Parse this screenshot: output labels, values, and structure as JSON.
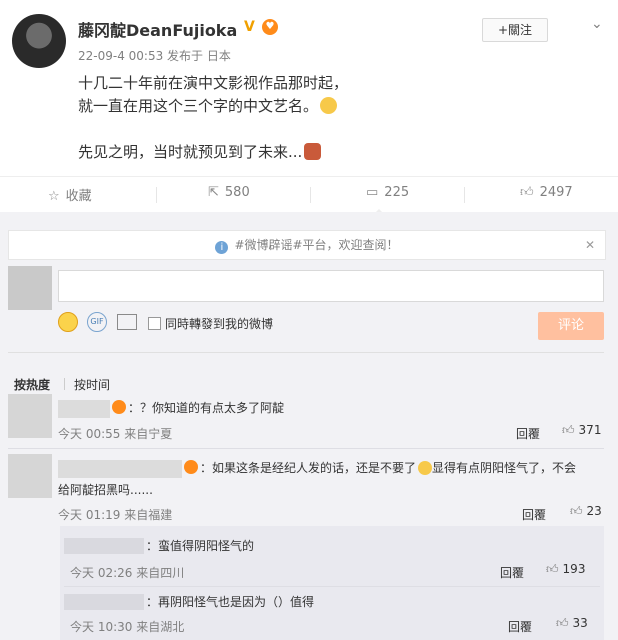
{
  "post": {
    "author": "藤冈靛DeanFujioka",
    "vip_icon": "V",
    "meta": "22-09-4 00:53 发布于 日本",
    "follow_label": "+關注",
    "more_icon": "chevron-down-icon",
    "lines": [
      "十几二十年前在演中文影视作品那时起，",
      "就一直在用这个三个字的中文艺名。",
      "",
      "先见之明，当时就预见到了未来..."
    ]
  },
  "actions": {
    "favorite_label": "收藏",
    "repost_count": "580",
    "comment_count": "225",
    "like_count": "2497"
  },
  "comment_box": {
    "notice": "#微博辟谣#平台，欢迎查阅！",
    "repost_option": "同時轉發到我的微博",
    "submit_label": "评论"
  },
  "sort": {
    "hot_label": "按热度",
    "time_label": "按时间"
  },
  "comments": [
    {
      "text": "：？你知道的有点太多了阿靛",
      "meta": "今天 00:55 来自宁夏",
      "reply_label": "回覆",
      "likes": "371"
    },
    {
      "text_line1": "：如果这条是经纪人发的话，还是不要了",
      "text_line1b": "显得有点阴阳怪气了，不会",
      "text_line2": "给阿靛招黑吗......",
      "meta": "今天 01:19 来自福建",
      "reply_label": "回覆",
      "likes": "23"
    }
  ],
  "replies": [
    {
      "text": "：蛮值得阴阳怪气的",
      "meta": "今天 02:26 来自四川",
      "reply_label": "回覆",
      "likes": "193"
    },
    {
      "text": "：再阴阳怪气也是因为（）值得",
      "meta": "今天 10:30 来自湖北",
      "reply_label": "回覆",
      "likes": "33"
    }
  ],
  "colors": {
    "panel_bg": "#f2f2f5",
    "submit_bg": "#ffc09f",
    "badge_orange": "#ff8b1a",
    "vip_gold": "#f0a000"
  }
}
